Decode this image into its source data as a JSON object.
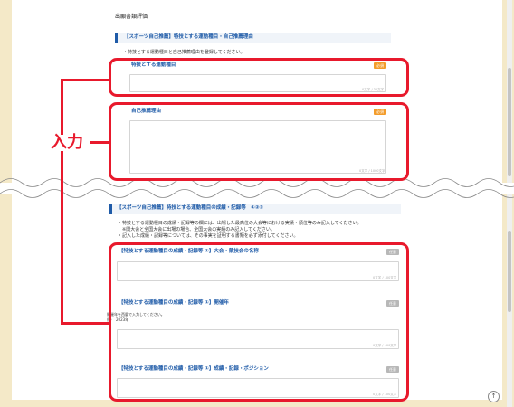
{
  "page_title": "出願書類評価",
  "section1": {
    "header": "【スポーツ自己推薦】特技とする運動種目・自己推薦理由",
    "note": "・特技とする運動種目と自己推薦理由を登録してください。",
    "field1_label": "特技とする運動種目",
    "field1_badge": "必須",
    "field1_counter": "0文字 / 30文字",
    "field2_label": "自己推薦理由",
    "field2_badge": "必須",
    "field2_counter": "0文字 / 1000文字"
  },
  "section2": {
    "header": "【スポーツ自己推薦】特技とする運動種目の成績・記録等　①②③",
    "note1": "・特技とする運動種目の成績・記録等の欄には、出場した最高位の大会等における実績・順位等のみ記入してください。",
    "note2": "　※関大会と全国大会に出場の場合、全国大会の実績のみ記入してください。",
    "note3": "・記入した成績・記録等については、その事実を証明する書類を必ず添付してください。",
    "field1_label": "【特技とする運動種目の成績・記録等 ①】大会・競技会の名称",
    "field1_badge": "任意",
    "field1_counter": "0文字 / 100文字",
    "field2_label": "【特技とする運動種目の成績・記録等 ①】開催年",
    "field2_badge": "任意",
    "field2_hint1": "開催年を西暦で入力してください。",
    "field2_hint2": "例）　2023年",
    "field2_counter": "0文字 / 100文字",
    "field3_label": "【特技とする運動種目の成績・記録等 ①】成績・記録・ポジション",
    "field3_badge": "任意",
    "field3_counter": "0文字 / 100文字"
  },
  "annotation_label": "入力",
  "scroll_top_icon": "↑",
  "colors": {
    "accent_blue": "#1f5ba8",
    "annotation_red": "#e8192c",
    "required_orange": "#f39c2a",
    "optional_gray": "#b8b8b8",
    "side_tan": "#f4e9c8"
  }
}
